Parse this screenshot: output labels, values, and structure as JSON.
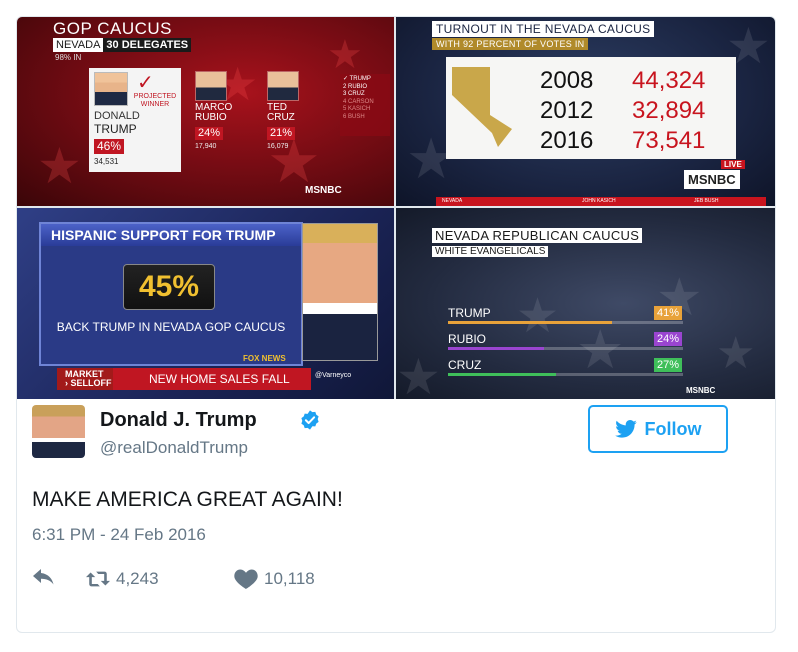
{
  "panel1": {
    "title": "GOP CAUCUS",
    "state": "NEVADA",
    "delegates": "30 DELEGATES",
    "percent_in": "98% IN",
    "winner": {
      "label_1": "PROJECTED",
      "label_2": "WINNER",
      "first_name": "DONALD",
      "last_name": "TRUMP",
      "percent": "46%",
      "votes": "34,531"
    },
    "candidates": [
      {
        "first": "MARCO",
        "last": "RUBIO",
        "percent": "24%",
        "votes": "17,940"
      },
      {
        "first": "TED",
        "last": "CRUZ",
        "percent": "21%",
        "votes": "16,079"
      }
    ],
    "ranking": [
      "✓ TRUMP",
      "2 RUBIO",
      "3 CRUZ",
      "4 CARSON",
      "5 KASICH",
      "6 BUSH"
    ],
    "network": "MSNBC"
  },
  "panel2": {
    "title": "TURNOUT IN THE NEVADA CAUCUS",
    "subtitle": "WITH 92 PERCENT OF VOTES IN",
    "rows": [
      {
        "year": "2008",
        "value": "44,324"
      },
      {
        "year": "2012",
        "value": "32,894"
      },
      {
        "year": "2016",
        "value": "73,541"
      }
    ],
    "live": "LIVE",
    "network": "MSNBC",
    "strip_1": "NEVADA",
    "strip_2": "JOHN KASICH",
    "strip_3": "JEB BUSH"
  },
  "panel3": {
    "title": "HISPANIC SUPPORT FOR TRUMP",
    "percent": "45%",
    "subtitle": "BACK TRUMP IN NEVADA GOP CAUCUS",
    "network": "FOX NEWS",
    "market_1": "MARKET",
    "market_2": "› SELLOFF",
    "ticker": "NEW HOME SALES FALL",
    "handle": "@Varneyco"
  },
  "panel4": {
    "title": "NEVADA REPUBLICAN CAUCUS",
    "subtitle": "WHITE EVANGELICALS",
    "bars": [
      {
        "name": "TRUMP",
        "value": 41,
        "label": "41%",
        "color": "#e8a23a"
      },
      {
        "name": "RUBIO",
        "value": 24,
        "label": "24%",
        "color": "#9a45d0"
      },
      {
        "name": "CRUZ",
        "value": 27,
        "label": "27%",
        "color": "#3fbf5a"
      }
    ],
    "network": "MSNBC"
  },
  "tweet": {
    "display_name": "Donald J. Trump",
    "handle": "@realDonaldTrump",
    "follow_label": "Follow",
    "text": "MAKE AMERICA GREAT AGAIN!",
    "timestamp": "6:31 PM - 24 Feb 2016",
    "retweets": "4,243",
    "likes": "10,118",
    "accent": "#1da1f2"
  }
}
